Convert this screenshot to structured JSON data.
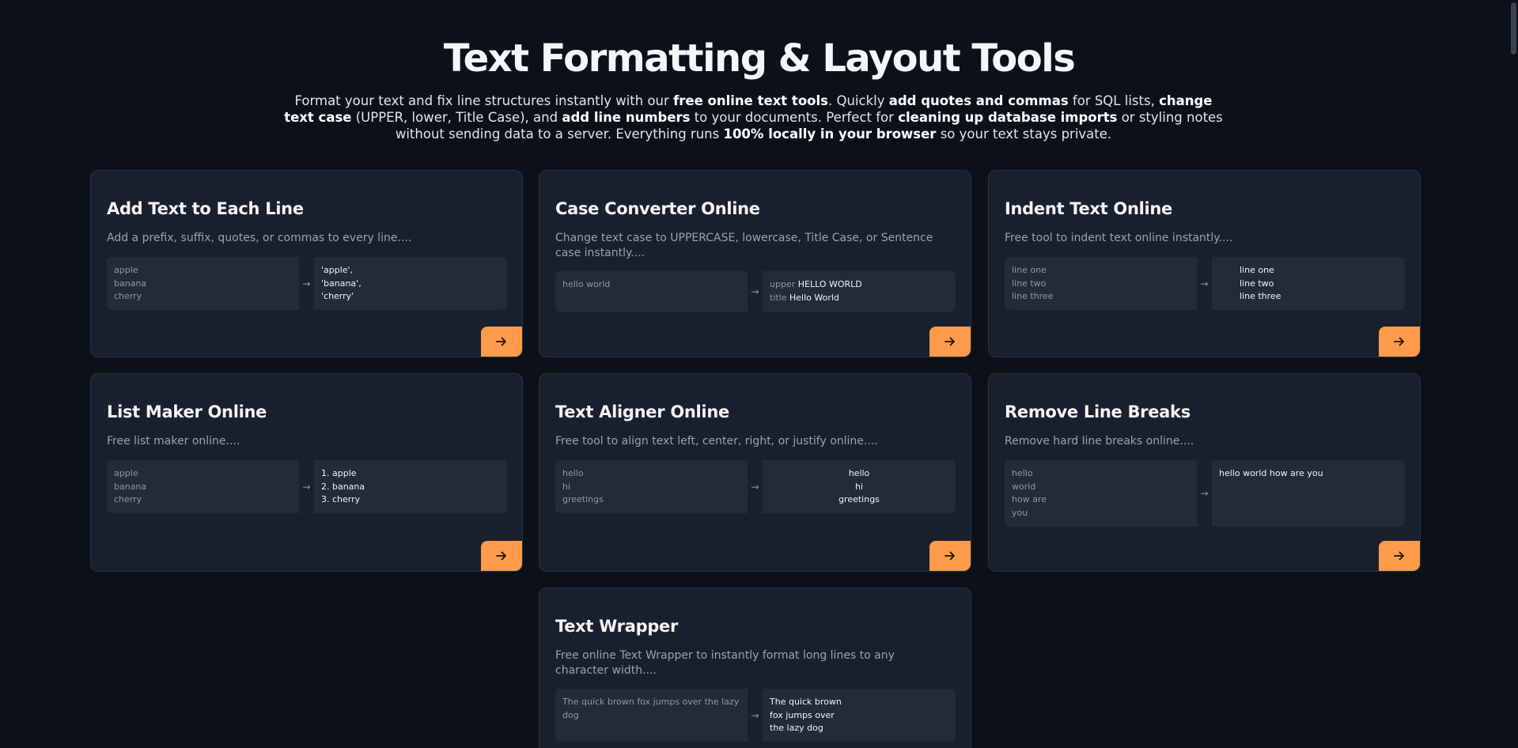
{
  "page": {
    "title": "Text Formatting & Layout Tools",
    "intro": [
      {
        "t": "Format your text and fix line structures instantly with our ",
        "b": false
      },
      {
        "t": "free online text tools",
        "b": true
      },
      {
        "t": ". Quickly ",
        "b": false
      },
      {
        "t": "add quotes and commas",
        "b": true
      },
      {
        "t": " for SQL lists, ",
        "b": false
      },
      {
        "t": "change text case",
        "b": true
      },
      {
        "t": " (UPPER, lower, Title Case), and ",
        "b": false
      },
      {
        "t": "add line numbers",
        "b": true
      },
      {
        "t": " to your documents. Perfect for ",
        "b": false
      },
      {
        "t": "cleaning up database imports",
        "b": true
      },
      {
        "t": " or styling notes without sending data to a server. Everything runs ",
        "b": false
      },
      {
        "t": "100% locally in your browser",
        "b": true
      },
      {
        "t": " so your text stays private.",
        "b": false
      }
    ]
  },
  "theme": {
    "accent": "#ff9a4a",
    "card_bg": "#19202d",
    "page_bg": "#0c1119"
  },
  "cards": [
    {
      "title": "Add Text to Each Line",
      "desc": "Add a prefix, suffix, quotes, or commas to every line....",
      "input": [
        "apple",
        "banana",
        "cherry"
      ],
      "output": [
        "'apple',",
        "'banana',",
        "'cherry'"
      ],
      "arrow": "→",
      "icon": "arrow-right-icon"
    },
    {
      "title": "Case Converter Online",
      "desc": "Change text case to UPPERCASE, lowercase, Title Case, or Sentence case instantly....",
      "input": [
        "hello world"
      ],
      "output": [
        {
          "label": "upper",
          "value": "HELLO WORLD"
        },
        {
          "label": "title",
          "value": "Hello World"
        }
      ],
      "arrow": "→",
      "icon": "arrow-right-icon"
    },
    {
      "title": "Indent Text Online",
      "desc": "Free tool to indent text online instantly....",
      "input": [
        "line one",
        "line two",
        "line three"
      ],
      "output": [
        "line one",
        "line two",
        "line three"
      ],
      "arrow": "→",
      "icon": "arrow-right-icon"
    },
    {
      "title": "List Maker Online",
      "desc": "Free list maker online....",
      "input": [
        "apple",
        "banana",
        "cherry"
      ],
      "output": [
        "1. apple",
        "2. banana",
        "3. cherry"
      ],
      "arrow": "→",
      "icon": "arrow-right-icon"
    },
    {
      "title": "Text Aligner Online",
      "desc": "Free tool to align text left, center, right, or justify online....",
      "input": [
        "hello",
        "hi",
        "greetings"
      ],
      "output": [
        "hello",
        "hi",
        "greetings"
      ],
      "arrow": "→",
      "icon": "arrow-right-icon"
    },
    {
      "title": "Remove Line Breaks",
      "desc": "Remove hard line breaks online....",
      "input": [
        "hello",
        "world",
        "how are",
        "you"
      ],
      "output": [
        "hello world how are you"
      ],
      "arrow": "→",
      "icon": "arrow-right-icon"
    },
    {
      "title": "Text Wrapper",
      "desc": "Free online Text Wrapper to instantly format long lines to any character width....",
      "input": [
        "The quick brown fox jumps over the lazy dog"
      ],
      "output": [
        "The quick brown",
        "fox jumps over",
        "the lazy dog"
      ],
      "arrow": "→",
      "icon": "arrow-right-icon"
    }
  ]
}
